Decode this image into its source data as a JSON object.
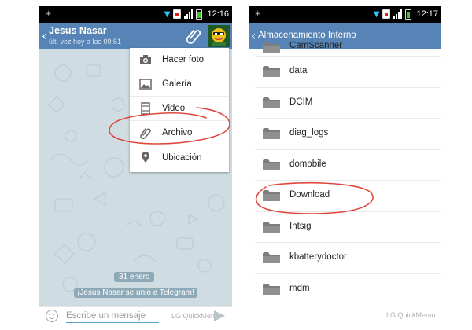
{
  "left": {
    "status_bar": {
      "time": "12:16"
    },
    "header": {
      "name": "Jesus Nasar",
      "status": "últ. vez hoy a las 09:51"
    },
    "attach_menu": {
      "items": [
        {
          "label": "Hacer foto",
          "icon": "camera-icon"
        },
        {
          "label": "Galería",
          "icon": "gallery-icon"
        },
        {
          "label": "Video",
          "icon": "video-icon"
        },
        {
          "label": "Archivo",
          "icon": "paperclip-icon"
        },
        {
          "label": "Ubicación",
          "icon": "location-pin-icon"
        }
      ]
    },
    "chat": {
      "date": "31 enero",
      "service_message": "¡Jesus Nasar se unió a Telegram!"
    },
    "input": {
      "placeholder": "Escribe un mensaje"
    },
    "watermark": "LG QuickMemo"
  },
  "right": {
    "status_bar": {
      "time": "12:17"
    },
    "header": {
      "title": "Almacenamiento Interno"
    },
    "folders": [
      "CamScanner",
      "data",
      "DCIM",
      "diag_logs",
      "domobile",
      "Download",
      "Intsig",
      "kbatterydoctor",
      "mdm"
    ],
    "watermark": "LG QuickMemo"
  },
  "colors": {
    "app_bar": "#5784b6",
    "chat_background": "#cfdde3",
    "annotation_red": "#e0463b"
  }
}
